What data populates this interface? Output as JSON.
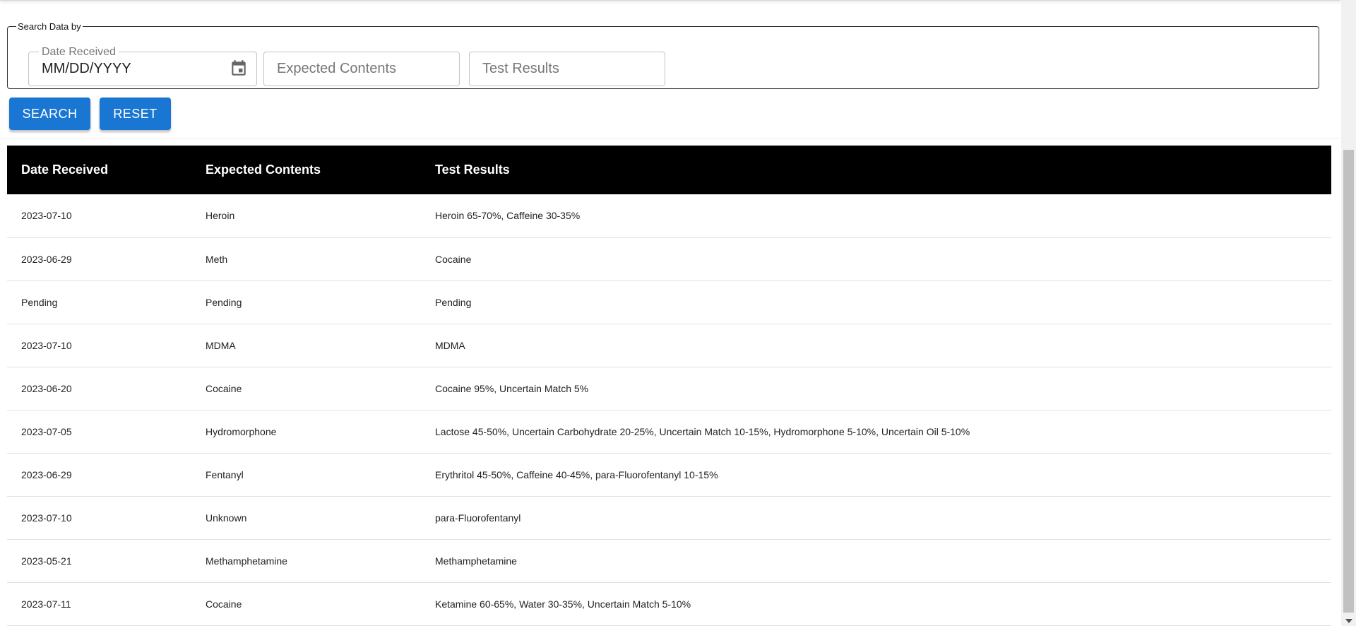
{
  "search": {
    "legend": "Search Data by",
    "date_label": "Date Received",
    "date_value": "MM/DD/YYYY",
    "expected_placeholder": "Expected Contents",
    "results_placeholder": "Test Results",
    "search_label": "SEARCH",
    "reset_label": "RESET"
  },
  "icons": {
    "calendar": "calendar-icon"
  },
  "colors": {
    "primary": "#1976d2",
    "header_bg": "#000000",
    "header_text": "#ffffff"
  },
  "table": {
    "headers": [
      "Date Received",
      "Expected Contents",
      "Test Results"
    ],
    "rows": [
      [
        "2023-07-10",
        "Heroin",
        "Heroin 65-70%, Caffeine 30-35%"
      ],
      [
        "2023-06-29",
        "Meth",
        "Cocaine"
      ],
      [
        "Pending",
        "Pending",
        "Pending"
      ],
      [
        "2023-07-10",
        "MDMA",
        "MDMA"
      ],
      [
        "2023-06-20",
        "Cocaine",
        "Cocaine 95%, Uncertain Match 5%"
      ],
      [
        "2023-07-05",
        "Hydromorphone",
        "Lactose 45-50%, Uncertain Carbohydrate 20-25%, Uncertain Match 10-15%, Hydromorphone 5-10%, Uncertain Oil 5-10%"
      ],
      [
        "2023-06-29",
        "Fentanyl",
        "Erythritol 45-50%, Caffeine 40-45%, para-Fluorofentanyl 10-15%"
      ],
      [
        "2023-07-10",
        "Unknown",
        "para-Fluorofentanyl"
      ],
      [
        "2023-05-21",
        "Methamphetamine",
        "Methamphetamine"
      ],
      [
        "2023-07-11",
        "Cocaine",
        "Ketamine 60-65%, Water 30-35%, Uncertain Match 5-10%"
      ]
    ]
  }
}
